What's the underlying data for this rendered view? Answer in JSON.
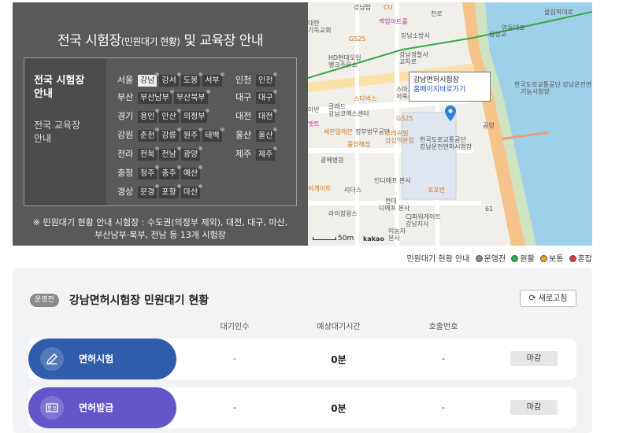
{
  "guide": {
    "title_main_a": "전국 시험장",
    "title_small": "(민원대기 현황)",
    "title_main_b": " 및 교육장 안내",
    "side_items": [
      "전국 시험장 안내",
      "전국 교육장 안내"
    ],
    "regions": [
      {
        "name": "서울",
        "chips": [
          "강남",
          "강서",
          "도봉",
          "서부"
        ],
        "selected": "강남"
      },
      {
        "name": "인천",
        "chips": [
          "인천"
        ]
      },
      {
        "name": "부산",
        "chips": [
          "부산남부",
          "부산북부"
        ]
      },
      {
        "name": "대구",
        "chips": [
          "대구"
        ]
      },
      {
        "name": "경기",
        "chips": [
          "용인",
          "안산",
          "의정부"
        ]
      },
      {
        "name": "대전",
        "chips": [
          "대전"
        ]
      },
      {
        "name": "강원",
        "chips": [
          "춘천",
          "강릉",
          "원주",
          "태백"
        ]
      },
      {
        "name": "울산",
        "chips": [
          "울산"
        ]
      },
      {
        "name": "전라",
        "chips": [
          "전북",
          "전남",
          "광양"
        ]
      },
      {
        "name": "제주",
        "chips": [
          "제주"
        ]
      },
      {
        "name": "충청",
        "chips": [
          "청주",
          "충주",
          "예산"
        ]
      },
      {
        "name": "경상",
        "chips": [
          "문경",
          "포항",
          "마산"
        ]
      }
    ],
    "note_line1": "※ 민원대기 현황 안내 시험장 : 수도권(의정부 제외), 대전, 대구, 마산,",
    "note_line2": "부산남부·북부, 전남 등 13개 시험장"
  },
  "map": {
    "pois": [
      {
        "text": "강남탑",
        "cls": ""
      },
      {
        "text": "CU",
        "cls": "o"
      },
      {
        "text": "대한",
        "cls": ""
      },
      {
        "text": "기독교회",
        "cls": ""
      },
      {
        "text": "백암아트홀",
        "cls": "p"
      },
      {
        "text": "GS25",
        "cls": "o"
      },
      {
        "text": "강남소방서",
        "cls": ""
      },
      {
        "text": "강남경찰서",
        "cls": ""
      },
      {
        "text": "교차로",
        "cls": ""
      },
      {
        "text": "HD현대오일",
        "cls": ""
      },
      {
        "text": "뱅크주유소",
        "cls": ""
      },
      {
        "text": "스타벅스",
        "cls": "o"
      },
      {
        "text": "스마트",
        "cls": ""
      },
      {
        "text": "저축은",
        "cls": ""
      },
      {
        "text": "글래드",
        "cls": ""
      },
      {
        "text": "강남코엑스센터",
        "cls": ""
      },
      {
        "text": "GS25",
        "cls": "o"
      },
      {
        "text": "정부법무공단",
        "cls": ""
      },
      {
        "text": "세븐일레븐",
        "cls": "o"
      },
      {
        "text": "중앙해장",
        "cls": "o"
      },
      {
        "text": "광혜병원",
        "cls": ""
      },
      {
        "text": "한국도로교통공단",
        "cls": ""
      },
      {
        "text": "강남운전면허시험장",
        "cls": ""
      },
      {
        "text": "후레쉬빌",
        "cls": "o"
      },
      {
        "text": "삼성역본점",
        "cls": "o"
      },
      {
        "text": "인디에프 본사",
        "cls": ""
      },
      {
        "text": "리더스",
        "cls": ""
      },
      {
        "text": "비게이트",
        "cls": "o"
      },
      {
        "text": "포포빈",
        "cls": "o"
      },
      {
        "text": "현대",
        "cls": ""
      },
      {
        "text": "디에프 본사",
        "cls": ""
      },
      {
        "text": "CJ파워게이트",
        "cls": ""
      },
      {
        "text": "강남지사",
        "cls": ""
      },
      {
        "text": "라이징윙스",
        "cls": ""
      },
      {
        "text": "이농자",
        "cls": ""
      },
      {
        "text": "본사",
        "cls": ""
      },
      {
        "text": "한국도로교통공단 강남운전면허",
        "cls": ""
      },
      {
        "text": "기능시험장",
        "cls": ""
      },
      {
        "text": "공영",
        "cls": ""
      },
      {
        "text": "올림픽대로",
        "cls": ""
      },
      {
        "text": "삼성교",
        "cls": ""
      },
      {
        "text": "영동대로",
        "cls": ""
      },
      {
        "text": "천로",
        "cls": ""
      },
      {
        "text": "61",
        "cls": ""
      },
      {
        "text": "아반",
        "cls": ""
      },
      {
        "text": "엣트",
        "cls": "p"
      }
    ],
    "infowin_title": "강남면허시험장",
    "infowin_link": "홈페이지바로가기",
    "scale_label": "50m",
    "attribution": "kakao"
  },
  "legend": {
    "title": "민원대기 현황 안내",
    "items": [
      {
        "label": "운영전",
        "color": "#8a8a8a"
      },
      {
        "label": "원활",
        "color": "#2bb24c"
      },
      {
        "label": "보통",
        "color": "#f0a020"
      },
      {
        "label": "혼잡",
        "color": "#e03a3a"
      }
    ]
  },
  "status": {
    "badge": "운영전",
    "title": "강남면허시험장 민원대기 현황",
    "refresh_label": "새로고침",
    "columns": [
      "대기인수",
      "예상대기시간",
      "호출번호"
    ],
    "rows": [
      {
        "service": "면허시험",
        "waiting": "-",
        "time": "0분",
        "call": "-",
        "state": "마감"
      },
      {
        "service": "면허발급",
        "waiting": "-",
        "time": "0분",
        "call": "-",
        "state": "마감"
      }
    ]
  }
}
